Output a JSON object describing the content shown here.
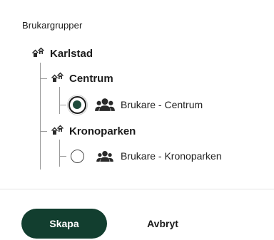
{
  "section": {
    "label": "Brukargrupper"
  },
  "tree": {
    "root": {
      "label": "Karlstad",
      "icon": "houses-icon"
    },
    "children": [
      {
        "label": "Centrum",
        "icon": "houses-icon",
        "leaf": {
          "label": "Brukare - Centrum",
          "icon": "people-icon",
          "selected": true
        }
      },
      {
        "label": "Kronoparken",
        "icon": "houses-icon",
        "leaf": {
          "label": "Brukare - Kronoparken",
          "icon": "people-icon",
          "selected": false
        }
      }
    ]
  },
  "actions": {
    "create_label": "Skapa",
    "cancel_label": "Avbryt"
  },
  "colors": {
    "primary": "#123e2f",
    "radio_fill": "#1f4a3b",
    "tree_line": "#9a9a9a"
  }
}
